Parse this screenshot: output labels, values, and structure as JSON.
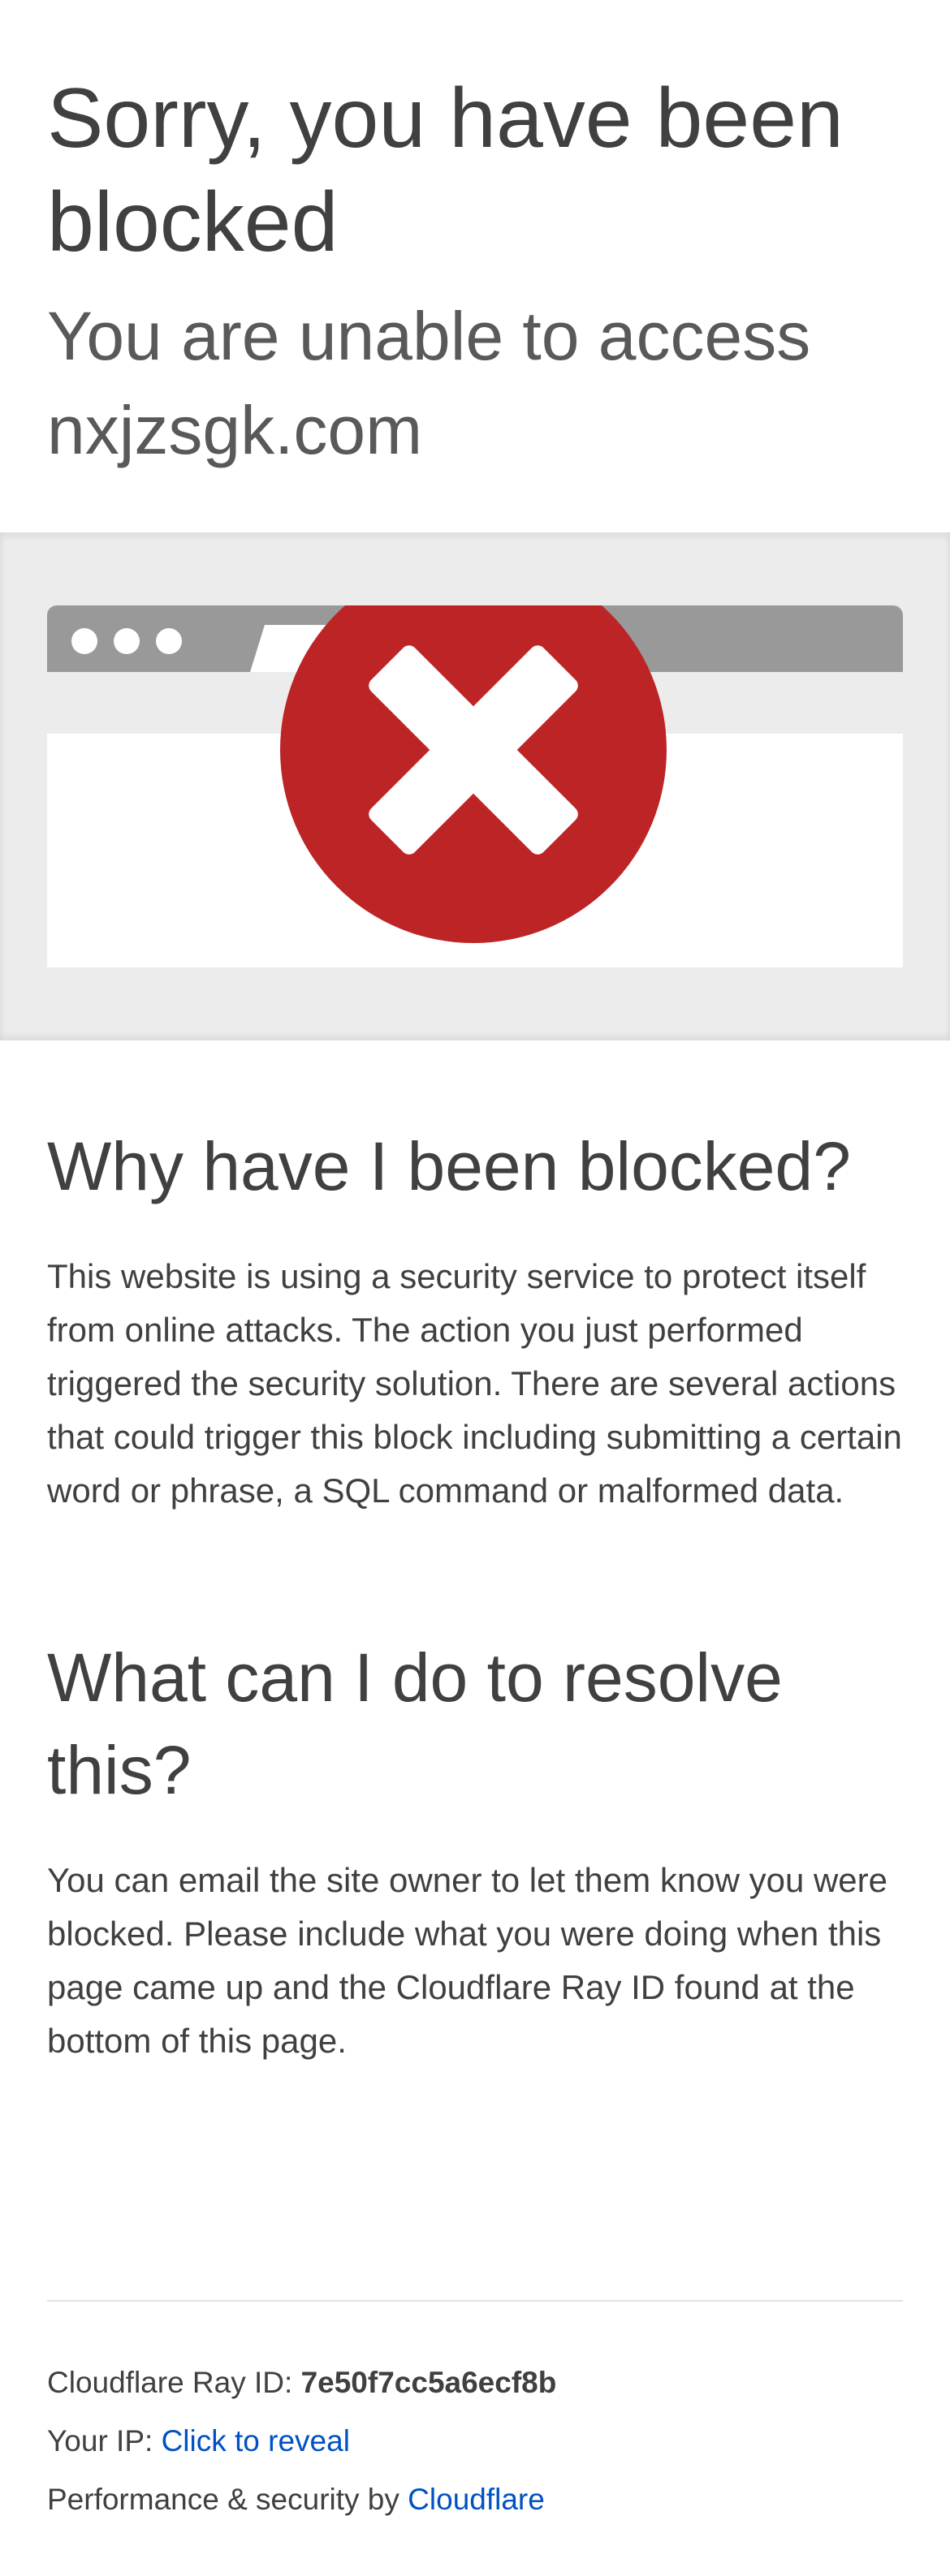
{
  "header": {
    "title": "Sorry, you have been blocked",
    "subtitle": "You are unable to access nxjzsgk.com"
  },
  "graphic": {
    "icon": "blocked-x-icon",
    "colors": {
      "circle": "#bd2426",
      "browser_bar": "#999999",
      "band": "#ececec"
    }
  },
  "why": {
    "heading": "Why have I been blocked?",
    "text": "This website is using a security service to protect itself from online attacks. The action you just performed triggered the security solution. There are several actions that could trigger this block including submitting a certain word or phrase, a SQL command or malformed data."
  },
  "resolve": {
    "heading": "What can I do to resolve this?",
    "text": "You can email the site owner to let them know you were blocked. Please include what you were doing when this page came up and the Cloudflare Ray ID found at the bottom of this page."
  },
  "footer": {
    "ray_label": "Cloudflare Ray ID: ",
    "ray_id": "7e50f7cc5a6ecf8b",
    "ip_label": "Your IP: ",
    "ip_link": "Click to reveal",
    "perf_label": "Performance & security by ",
    "perf_link": "Cloudflare",
    "link_color": "#0051c3"
  }
}
